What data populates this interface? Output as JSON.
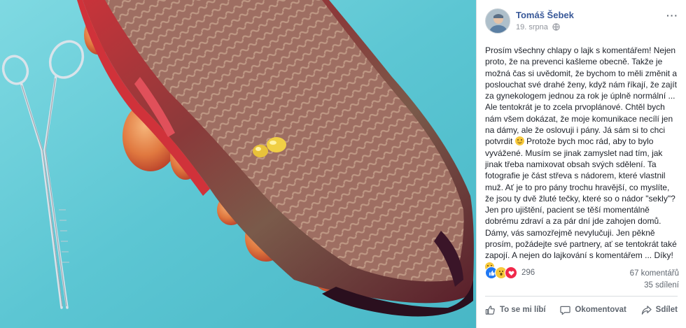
{
  "post": {
    "author": "Tomáš Šebek",
    "date": "19. srpna",
    "privacy_icon": "globe-icon",
    "more_label": "···",
    "paragraphs": [
      "Prosím všechny chlapy o lajk s komentářem! Nejen proto, že na prevenci kašleme obecně. Takže je možná čas si uvědomit, že bychom to měli změnit a poslouchat své drahé ženy, když nám říkají, že zajít za gynekologem jednou za rok je úplně normální ... Ale tentokrát je to zcela prvoplánové. Chtěl bych nám všem dokázat, že moje komunikace necílí jen na dámy, ale že oslovuji i pány. Já sám si to chci potvrdit",
      " Protože bych moc rád, aby to bylo vyvážené. Musím se jinak zamyslet nad tím, jak jinak třeba namixovat obsah svých sdělení. Ta fotografie je část střeva s nádorem, které vlastnil muž. Ať je to pro pány trochu hravější, co myslíte, že jsou ty dvě žluté tečky, které so o nádor \"sekly\"? Jen pro ujištění, pacient se těší momentálně dobrému zdraví a za pár dní jde zahojen domů. Dámy, vás samozřejmě nevylučuji. Jen pěkně prosím, požádejte své partnery, ať se tentokrát také zapojí. A nejen do lajkování s komentářem ... Díky!"
    ]
  },
  "reactions": {
    "icons": [
      "like-icon",
      "wow-icon",
      "love-icon"
    ],
    "count": "296",
    "comments": "67 komentářů",
    "shares": "35 sdílení"
  },
  "actions": {
    "like": "To se mi líbí",
    "comment": "Okomentovat",
    "share": "Sdílet"
  },
  "colors": {
    "author_link": "#385898",
    "like_blue": "#2078f4",
    "love_red": "#f0284a",
    "wow_yellow": "#f7c93b",
    "drape_blue": "#5ec8d4"
  }
}
